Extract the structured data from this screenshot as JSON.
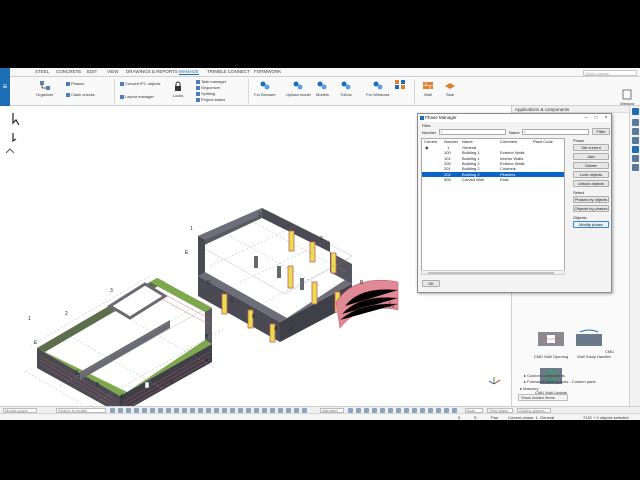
{
  "ribbon": {
    "tabs": [
      "STEEL",
      "CONCRETE",
      "EDIT",
      "VIEW",
      "DRAWINGS & REPORTS",
      "MANAGE",
      "TRIMBLE CONNECT",
      "FORMWORK"
    ],
    "active_tab": "MANAGE",
    "quick_launch_placeholder": "Quick Launch",
    "organizer": "Organizer",
    "phases": "Phases",
    "clash_checks": "Clash checks",
    "convert_ifc": "Convert IFC objects",
    "layout_manager": "Layout manager",
    "locks": "Locks",
    "task_manager": "Task manager",
    "sequencer": "Sequencer",
    "splitting": "Splitting",
    "project_status": "Project status",
    "for_browser": "For Browser",
    "upload_model": "Upload model",
    "models": "Models",
    "todos": "ToDos",
    "for_windows": "For Windows",
    "wall": "Wall",
    "slab": "Slab",
    "window": "Window"
  },
  "right_panel": {
    "title": "Applications & components",
    "components": [
      "CMU Wall Opening",
      "CMU Wall Swap Handler",
      "CMU Wall Update"
    ],
    "tree": [
      "Custom Components",
      "Formwork placing tools - Custom parts",
      "Masonry"
    ],
    "show_hidden": "Show hidden items"
  },
  "phase_manager": {
    "title": "Phase Manager",
    "filter_label": "Filter",
    "number_label": "Number",
    "number_value": "*",
    "name_label": "Name",
    "name_value": "*",
    "filter_button": "Filter",
    "columns": [
      "Current",
      "Number",
      "Name",
      "Comment",
      "Plant Code"
    ],
    "rows": [
      {
        "current": "◉",
        "number": "1",
        "name": "General",
        "comment": ""
      },
      {
        "current": "",
        "number": "100",
        "name": "Building 1",
        "comment": "Exterior Walls"
      },
      {
        "current": "",
        "number": "101",
        "name": "Building 1",
        "comment": "Interior Walls"
      },
      {
        "current": "",
        "number": "200",
        "name": "Building 2",
        "comment": "Exterior Walls"
      },
      {
        "current": "",
        "number": "201",
        "name": "Building 2",
        "comment": "Columns"
      },
      {
        "current": "",
        "number": "202",
        "name": "Building 2",
        "comment": "Pilasters"
      },
      {
        "current": "",
        "number": "300",
        "name": "Curved Wall",
        "comment": "Exist"
      }
    ],
    "selected_row": 5,
    "phase_group": "Phase",
    "set_current": "Set current",
    "add": "Add",
    "delete": "Delete",
    "lock_objects": "Lock objects",
    "unlock_objects": "Unlock objects",
    "select_group": "Select",
    "phases_by_objects": "Phases by objects",
    "objects_by_phases": "Objects by phases",
    "objects_group": "Objects",
    "modify_phase": "Modify phase",
    "ok": "OK"
  },
  "bottom_bar": {
    "model_scope": "Model scope",
    "search_placeholder": "Search in model",
    "standard": "standard",
    "auto": "Auto",
    "view_plane": "View plane",
    "outline_planes": "Outline planes"
  },
  "status_bar": {
    "coord_0": "0",
    "coord_s": "S",
    "pan": "Pan",
    "current_phase": "Current phase: 1, General",
    "selection": "7192 + 0 objects selected"
  },
  "viewport_labels": [
    "1",
    "2",
    "3",
    "A",
    "B",
    "C",
    "D",
    "E"
  ],
  "colors": {
    "accent": "#1c6fb5",
    "wall_face": "#4a4a52",
    "brick": "#c95b6b",
    "pilaster_yellow": "#e8e04a",
    "mesh_green": "#7ea84b",
    "selection": "#0a64c8"
  }
}
